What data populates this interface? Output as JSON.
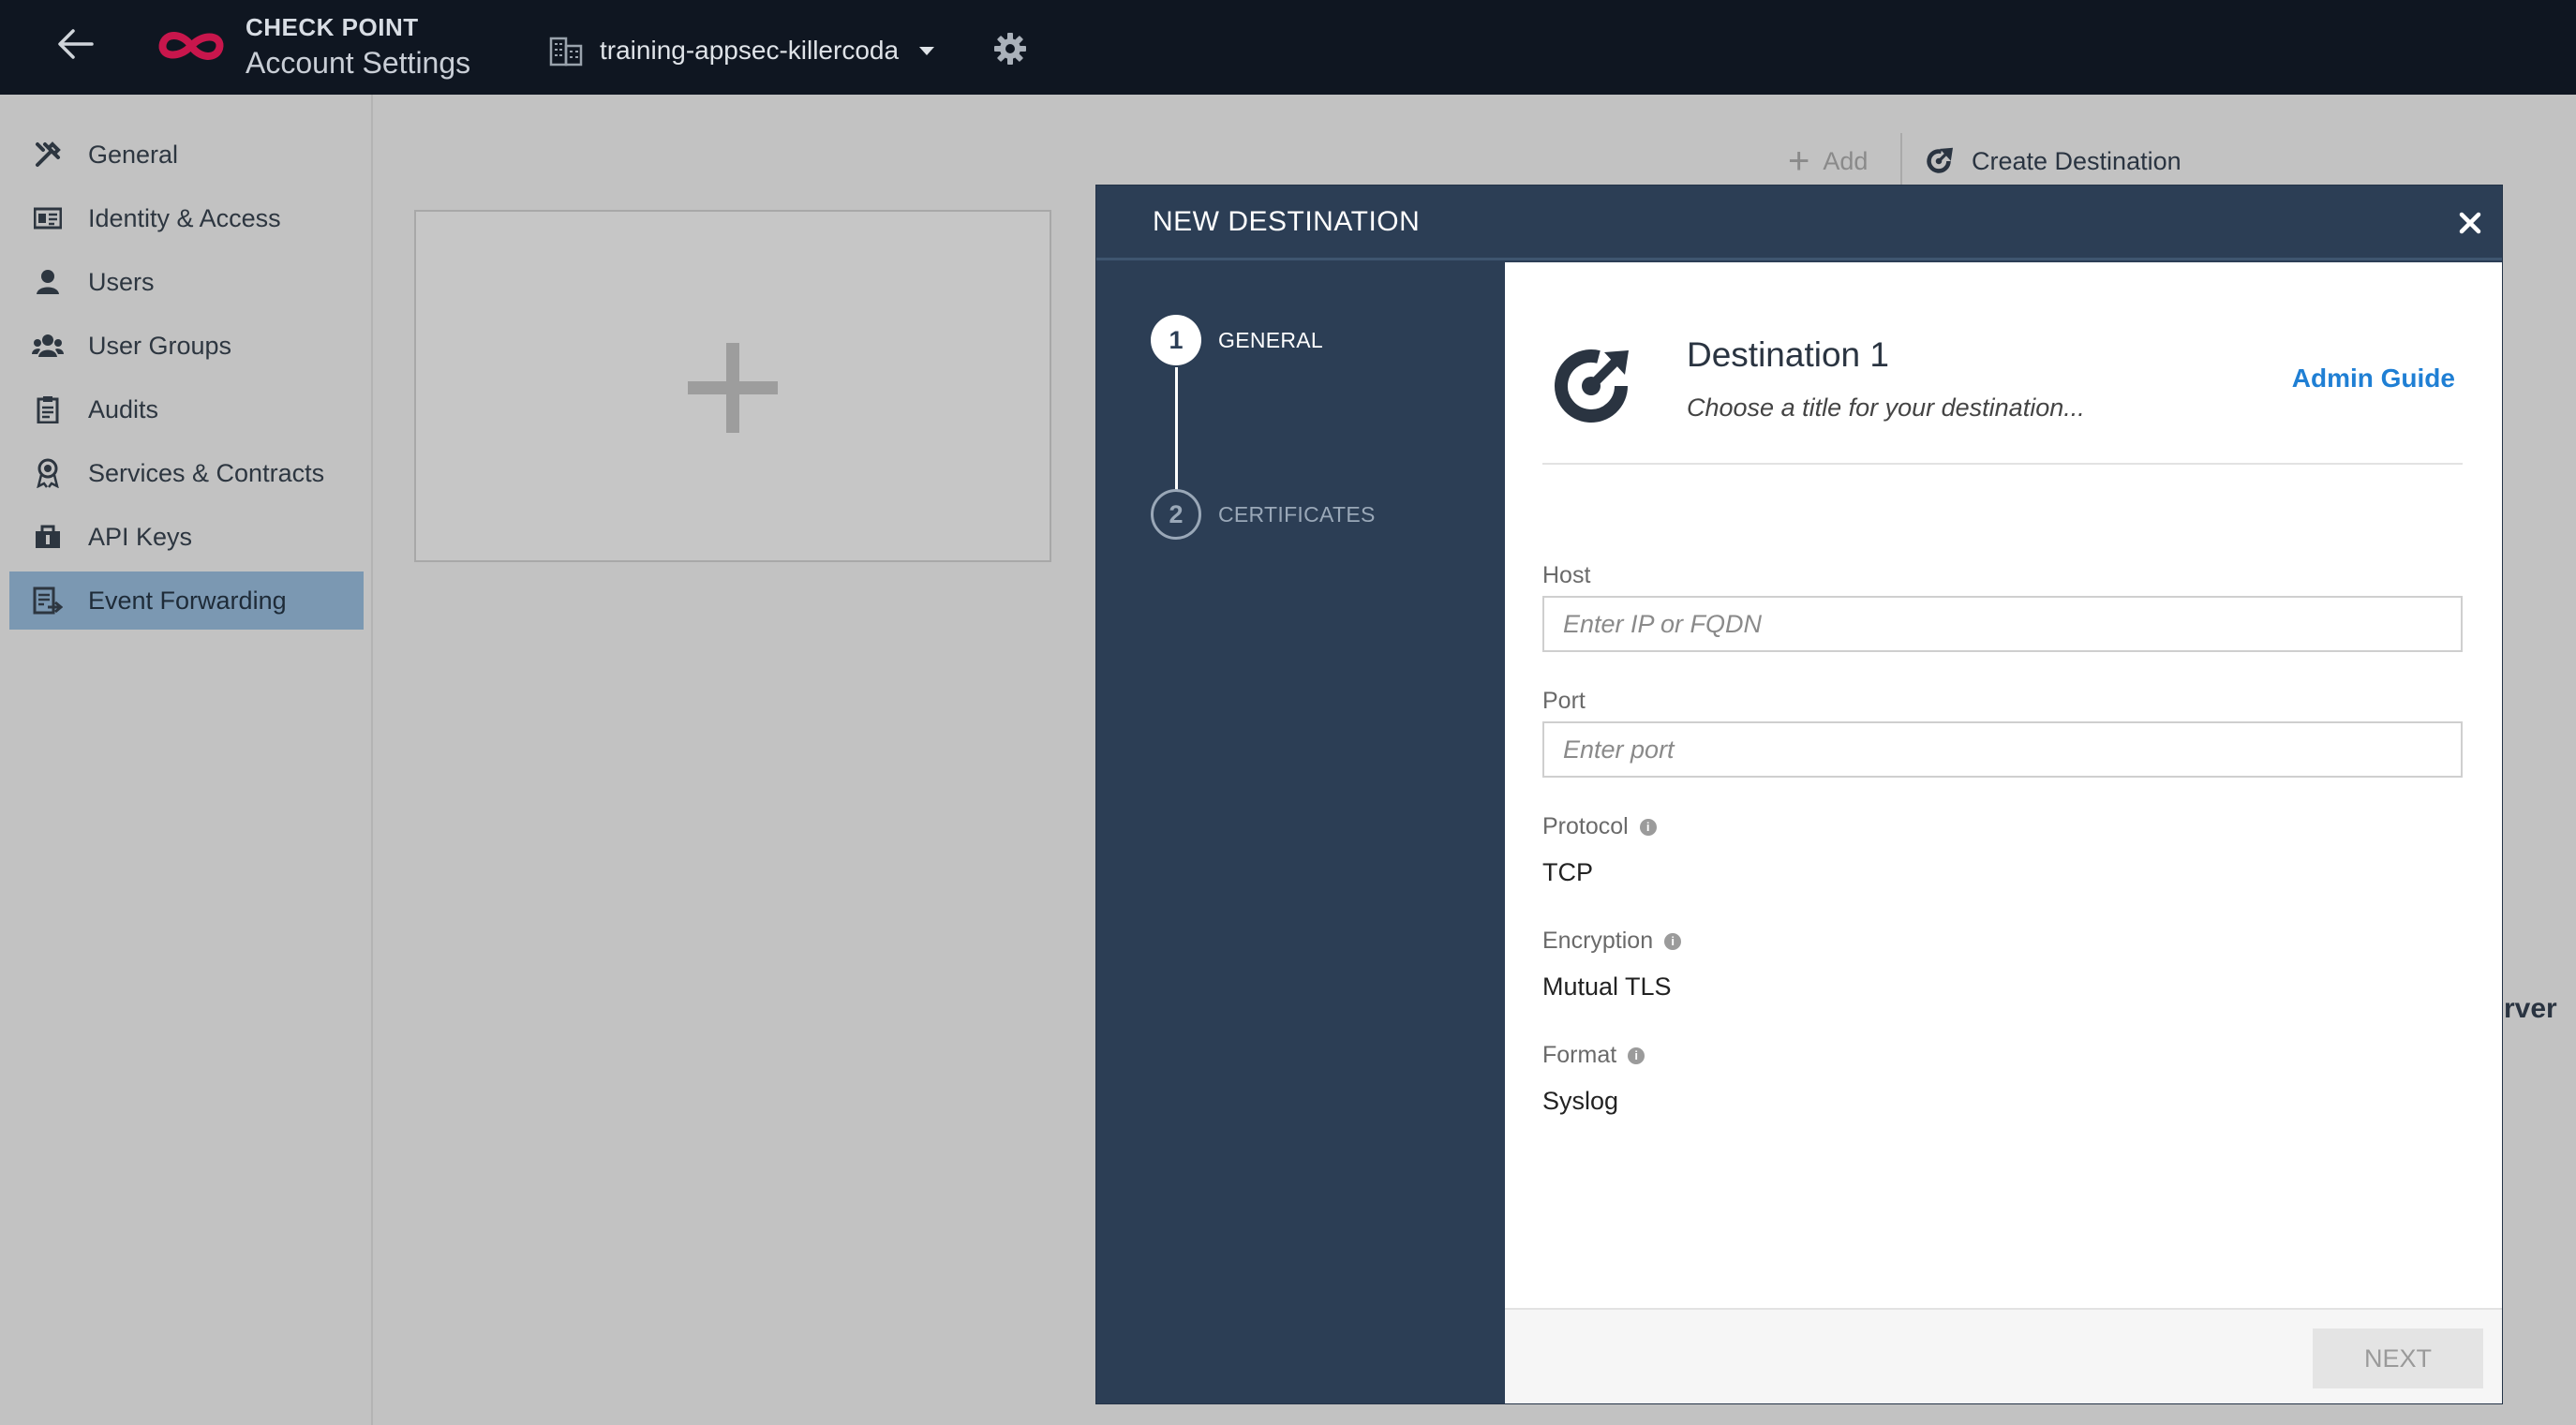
{
  "topbar": {
    "brand_top": "CHECK POINT",
    "brand_bottom": "Account Settings",
    "account_name": "training-appsec-killercoda"
  },
  "sidebar": {
    "items": [
      {
        "label": "General",
        "icon": "tools-icon"
      },
      {
        "label": "Identity & Access",
        "icon": "id-card-icon"
      },
      {
        "label": "Users",
        "icon": "user-icon"
      },
      {
        "label": "User Groups",
        "icon": "users-icon"
      },
      {
        "label": "Audits",
        "icon": "clipboard-icon"
      },
      {
        "label": "Services & Contracts",
        "icon": "award-icon"
      },
      {
        "label": "API Keys",
        "icon": "key-box-icon"
      },
      {
        "label": "Event Forwarding",
        "icon": "forward-list-icon",
        "active": true
      }
    ]
  },
  "main": {
    "add_label": "Add",
    "create_destination_label": "Create Destination",
    "peek_text": "rver"
  },
  "modal": {
    "title": "NEW DESTINATION",
    "steps": [
      {
        "number": "1",
        "label": "GENERAL"
      },
      {
        "number": "2",
        "label": "CERTIFICATES"
      }
    ],
    "destination_name": "Destination 1",
    "destination_subtitle": "Choose a title for your destination...",
    "admin_guide": "Admin Guide",
    "host_label": "Host",
    "host_placeholder": "Enter IP or FQDN",
    "port_label": "Port",
    "port_placeholder": "Enter port",
    "protocol_label": "Protocol",
    "protocol_value": "TCP",
    "encryption_label": "Encryption",
    "encryption_value": "Mutual TLS",
    "format_label": "Format",
    "format_value": "Syslog",
    "next_label": "NEXT"
  },
  "colors": {
    "topbar": "#0f1621",
    "modal_dark": "#2c3e55",
    "active_sidebar": "#7b98b2",
    "link": "#1f7fd4",
    "brand_logo": "#c8164c"
  }
}
